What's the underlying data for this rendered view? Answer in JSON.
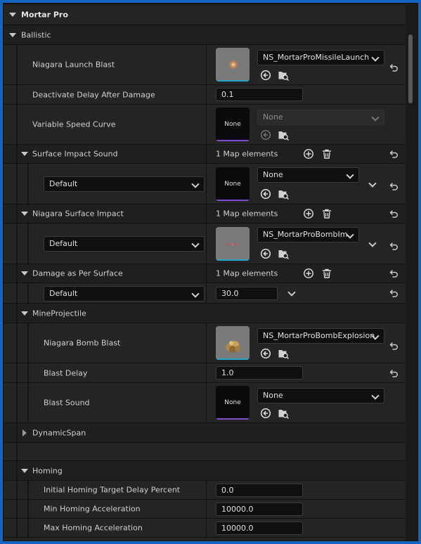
{
  "panel": {
    "title": "Mortar Pro",
    "ballistic": {
      "title": "Ballistic",
      "niagara_launch_blast": {
        "label": "Niagara Launch Blast",
        "value": "NS_MortarProMissileLaunch"
      },
      "deactivate_delay": {
        "label": "Deactivate Delay After Damage",
        "value": "0.1"
      },
      "variable_speed_curve": {
        "label": "Variable Speed Curve",
        "value": "None",
        "thumb": "None"
      },
      "surface_impact_sound": {
        "label": "Surface Impact Sound",
        "count": "1 Map elements",
        "key": "Default",
        "value": "None",
        "thumb": "None"
      },
      "niagara_surface_impact": {
        "label": "Niagara Surface Impact",
        "count": "1 Map elements",
        "key": "Default",
        "value": "NS_MortarProBombIm"
      },
      "damage_per_surface": {
        "label": "Damage as Per Surface",
        "count": "1 Map elements",
        "key": "Default",
        "value": "30.0"
      }
    },
    "mine_projectile": {
      "title": "MineProjectile",
      "niagara_bomb_blast": {
        "label": "Niagara Bomb Blast",
        "value": "NS_MortarProBombExplosion"
      },
      "blast_delay": {
        "label": "Blast Delay",
        "value": "1.0"
      },
      "blast_sound": {
        "label": "Blast Sound",
        "value": "None",
        "thumb": "None"
      }
    },
    "dynamic_span": {
      "title": "DynamicSpan"
    },
    "homing": {
      "title": "Homing",
      "initial_delay": {
        "label": "Initial Homing Target Delay Percent",
        "value": "0.0"
      },
      "min_accel": {
        "label": "Min Homing Acceleration",
        "value": "10000.0"
      },
      "max_accel": {
        "label": "Max Homing Acceleration",
        "value": "10000.0"
      }
    }
  },
  "colors": {
    "frame_border": "#1565c0",
    "panel_bg": "#1a1a1a",
    "asset_bar": "#7b4fd0",
    "niagara_bar": "#25a6c9"
  },
  "icons": [
    "reset-to-default-icon",
    "use-selected-asset-icon",
    "browse-asset-icon",
    "add-element-icon",
    "delete-elements-icon",
    "chevron-down-icon",
    "expand-arrow-icon"
  ]
}
